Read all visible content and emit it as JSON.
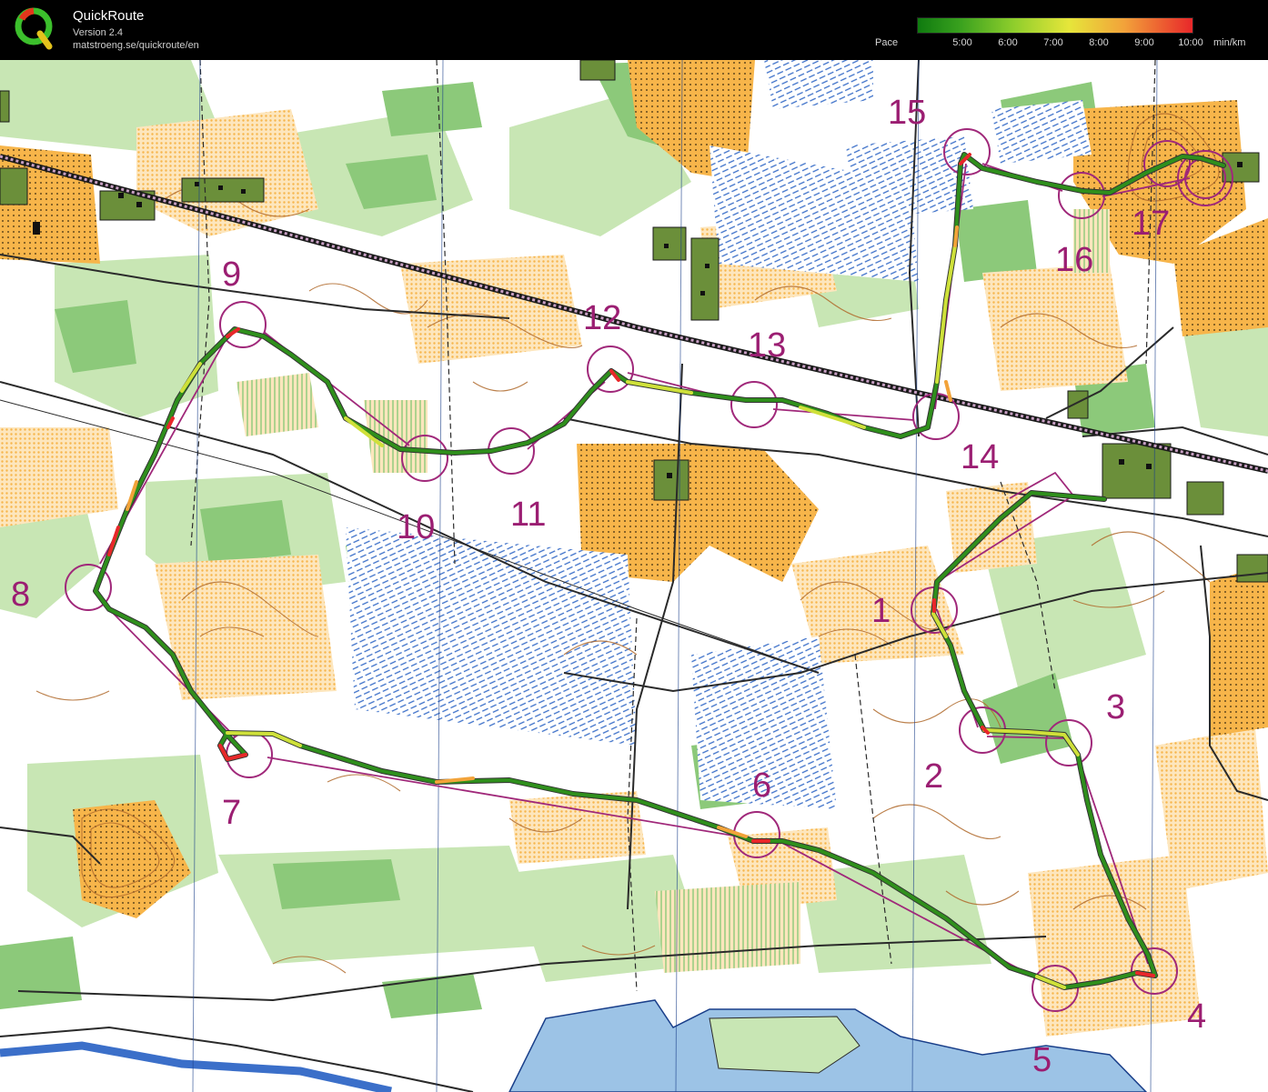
{
  "app": {
    "name": "QuickRoute",
    "version": "Version 2.4",
    "url": "matstroeng.se/quickroute/en"
  },
  "pace_legend": {
    "label": "Pace",
    "ticks": [
      "5:00",
      "6:00",
      "7:00",
      "8:00",
      "9:00",
      "10:00"
    ],
    "unit": "min/km",
    "colors": [
      "#0f7a0f",
      "#38a01e",
      "#8fce2c",
      "#e6e63a",
      "#f2a33a",
      "#e8272a"
    ]
  },
  "map": {
    "colors": {
      "white_forest": "#ffffff",
      "green_vegetation": "#8cc97a",
      "light_green": "#c8e6b4",
      "open_land": "#f7b54a",
      "marsh_blue": "#3b6fc9",
      "water": "#9cc3e6",
      "course_magenta": "#a0287a",
      "contour_brown": "#b06a2c",
      "building_olive": "#6b8f3a"
    },
    "controls": [
      "1",
      "2",
      "3",
      "4",
      "5",
      "6",
      "7",
      "8",
      "9",
      "10",
      "11",
      "12",
      "13",
      "14",
      "15",
      "16",
      "17"
    ]
  }
}
